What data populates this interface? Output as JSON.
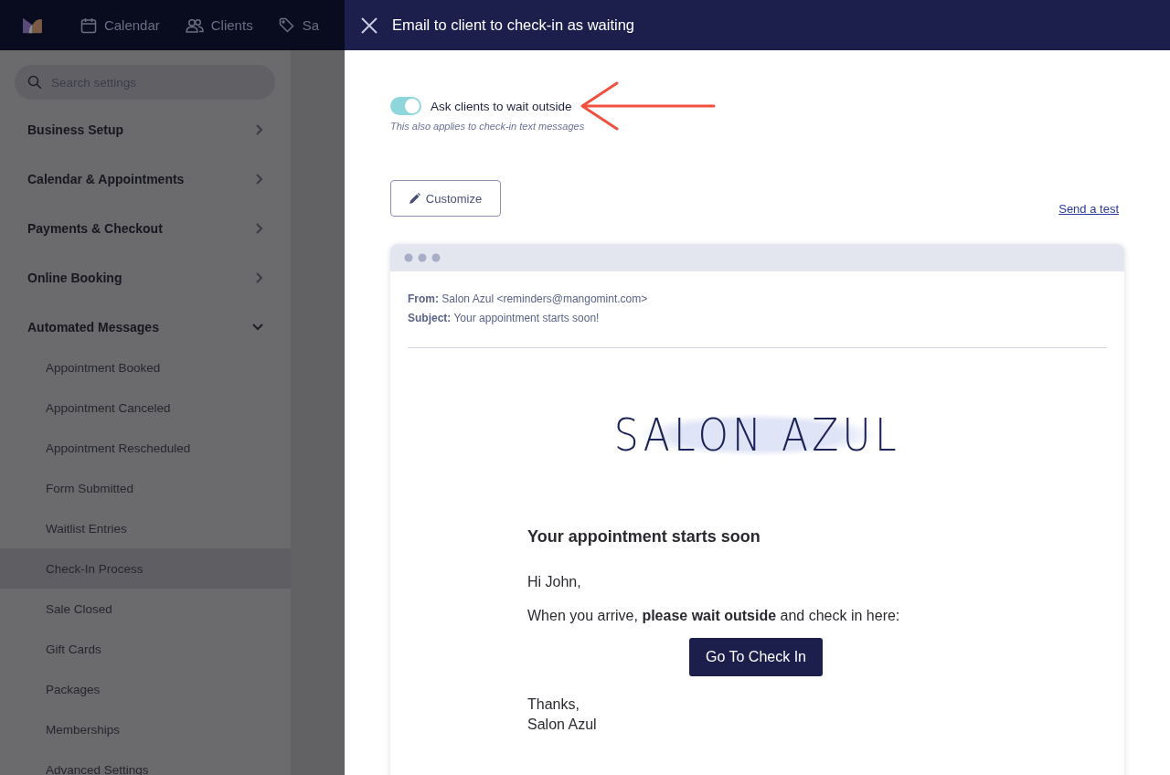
{
  "nav": {
    "items": [
      {
        "label": "Calendar",
        "kind": "calendar"
      },
      {
        "label": "Clients",
        "kind": "people"
      },
      {
        "label": "Sa",
        "kind": "tag"
      }
    ]
  },
  "search": {
    "placeholder": "Search settings"
  },
  "sidebar": {
    "sections": [
      {
        "label": "Business Setup",
        "expanded": false
      },
      {
        "label": "Calendar & Appointments",
        "expanded": false
      },
      {
        "label": "Payments & Checkout",
        "expanded": false
      },
      {
        "label": "Online Booking",
        "expanded": false
      },
      {
        "label": "Automated Messages",
        "expanded": true,
        "children": [
          {
            "label": "Appointment Booked",
            "selected": false
          },
          {
            "label": "Appointment Canceled",
            "selected": false
          },
          {
            "label": "Appointment Rescheduled",
            "selected": false
          },
          {
            "label": "Form Submitted",
            "selected": false
          },
          {
            "label": "Waitlist Entries",
            "selected": false
          },
          {
            "label": "Check-In Process",
            "selected": true
          },
          {
            "label": "Sale Closed",
            "selected": false
          },
          {
            "label": "Gift Cards",
            "selected": false
          },
          {
            "label": "Packages",
            "selected": false
          },
          {
            "label": "Memberships",
            "selected": false
          },
          {
            "label": "Advanced Settings",
            "selected": false
          }
        ]
      }
    ]
  },
  "panel": {
    "title": "Email to client to check-in as waiting",
    "toggle": {
      "label": "Ask clients to wait outside",
      "on": true
    },
    "hint": "This also applies to check-in text messages",
    "customize_button": "Customize",
    "send_test_link": "Send a test",
    "email": {
      "from_label": "From:",
      "from": "Salon Azul <reminders@mangomint.com>",
      "subject_label": "Subject:",
      "subject": "Your appointment starts soon!",
      "logo_text": "SALON AZUL",
      "heading": "Your appointment starts soon",
      "greeting": "Hi John,",
      "body": "When you arrive, **please wait outside** and check in here:",
      "button": "Go To Check In",
      "sign_off": "Thanks,",
      "signature": "Salon Azul"
    }
  }
}
